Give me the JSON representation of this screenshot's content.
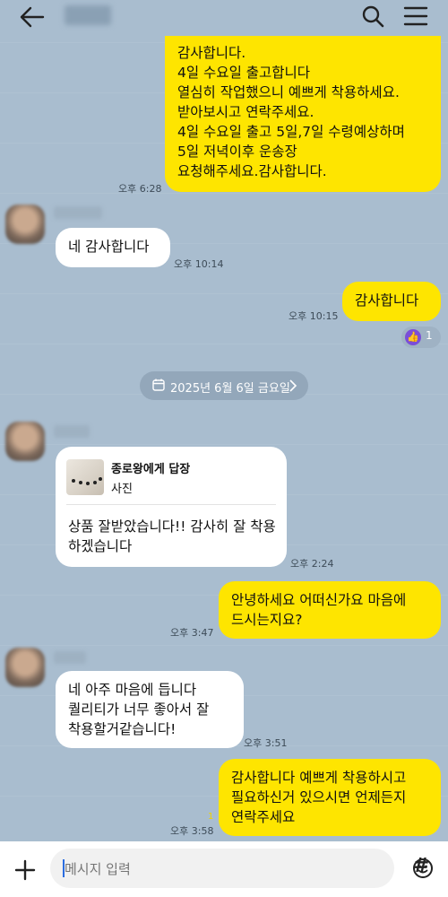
{
  "messages": {
    "m1": {
      "lines": [
        "감사합니다.",
        "4일 수요일 출고합니다",
        "열심히 작업했으니 예쁘게 착용하세요.",
        "받아보시고 연락주세요.",
        "4일 수요일 출고 5일,7일 수령예상하며",
        "5일 저녁이후 운송장",
        "요청해주세요.감사합니다."
      ],
      "time": "오후 6:28"
    },
    "m2": {
      "text": "네 감사합니다",
      "time": "오후 10:14"
    },
    "m3": {
      "text": "감사합니다",
      "time": "오후 10:15",
      "reaction_count": "1"
    },
    "date_divider": "2025년 6월 6일 금요일",
    "m4": {
      "reply_to": "종로왕에게 답장",
      "reply_type": "사진",
      "lines": [
        "상품 잘받았습니다!! 감사히 잘",
        "착용하겠습니다"
      ],
      "time": "오후 2:24"
    },
    "m5": {
      "lines": [
        "안녕하세요 어떠신가요 마음에",
        "드시는지요?"
      ],
      "time": "오후 3:47"
    },
    "m6": {
      "lines": [
        "네 아주 마음에 듭니다",
        "퀄리티가 너무 좋아서 잘",
        "착용할거같습니다!"
      ],
      "time": "오후 3:51"
    },
    "m7": {
      "lines": [
        "감사합니다 예쁘게 착용하시고",
        "필요하신거 있으시면 언제든지",
        "연락주세요"
      ],
      "time": "오후 3:58",
      "unread": "1"
    }
  },
  "input": {
    "placeholder": "메시지 입력"
  },
  "colors": {
    "background": "#a9bdcf",
    "my_bubble": "#fee500",
    "other_bubble": "#ffffff",
    "reaction": "#7b4ed8"
  },
  "icons": [
    "back-arrow-icon",
    "search-icon",
    "menu-icon",
    "thumbs-up-icon",
    "calendar-icon",
    "chevron-right-icon",
    "plus-icon",
    "emoji-icon",
    "hash-icon"
  ]
}
